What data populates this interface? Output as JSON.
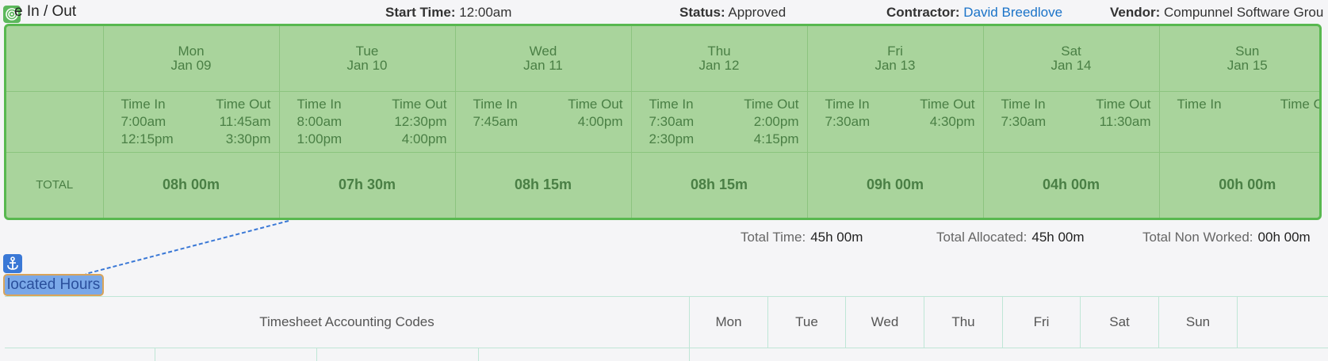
{
  "header": {
    "title": "e In / Out",
    "start_time_label": "Start Time:",
    "start_time_value": "12:00am",
    "status_label": "Status:",
    "status_value": "Approved",
    "contractor_label": "Contractor:",
    "contractor_value": "David Breedlove",
    "vendor_label": "Vendor:",
    "vendor_value": "Compunnel Software Grou"
  },
  "days": [
    {
      "day": "Mon",
      "date": "Jan 09",
      "in_label": "Time In",
      "out_label": "Time Out",
      "ins": [
        "7:00am",
        "12:15pm"
      ],
      "outs": [
        "11:45am",
        "3:30pm"
      ],
      "total": "08h 00m"
    },
    {
      "day": "Tue",
      "date": "Jan 10",
      "in_label": "Time In",
      "out_label": "Time Out",
      "ins": [
        "8:00am",
        "1:00pm"
      ],
      "outs": [
        "12:30pm",
        "4:00pm"
      ],
      "total": "07h 30m"
    },
    {
      "day": "Wed",
      "date": "Jan 11",
      "in_label": "Time In",
      "out_label": "Time Out",
      "ins": [
        "7:45am"
      ],
      "outs": [
        "4:00pm"
      ],
      "total": "08h 15m"
    },
    {
      "day": "Thu",
      "date": "Jan 12",
      "in_label": "Time In",
      "out_label": "Time Out",
      "ins": [
        "7:30am",
        "2:30pm"
      ],
      "outs": [
        "2:00pm",
        "4:15pm"
      ],
      "total": "08h 15m"
    },
    {
      "day": "Fri",
      "date": "Jan 13",
      "in_label": "Time In",
      "out_label": "Time Out",
      "ins": [
        "7:30am"
      ],
      "outs": [
        "4:30pm"
      ],
      "total": "09h 00m"
    },
    {
      "day": "Sat",
      "date": "Jan 14",
      "in_label": "Time In",
      "out_label": "Time Out",
      "ins": [
        "7:30am"
      ],
      "outs": [
        "11:30am"
      ],
      "total": "04h 00m"
    },
    {
      "day": "Sun",
      "date": "Jan 15",
      "in_label": "Time In",
      "out_label": "Time Out",
      "ins": [],
      "outs": [],
      "total": "00h 00m"
    }
  ],
  "total_row_label": "TOTAL",
  "summary": {
    "total_time_label": "Total Time:",
    "total_time_value": "45h 00m",
    "total_allocated_label": "Total Allocated:",
    "total_allocated_value": "45h 00m",
    "total_non_worked_label": "Total Non Worked:",
    "total_non_worked_value": "00h 00m"
  },
  "allocated_section_label": "located Hours",
  "accounting": {
    "codes_header": "Timesheet Accounting Codes",
    "day_headers": [
      "Mon",
      "Tue",
      "Wed",
      "Thu",
      "Fri",
      "Sat",
      "Sun"
    ]
  },
  "icons": {
    "target": "target-icon",
    "anchor": "anchor-icon"
  }
}
